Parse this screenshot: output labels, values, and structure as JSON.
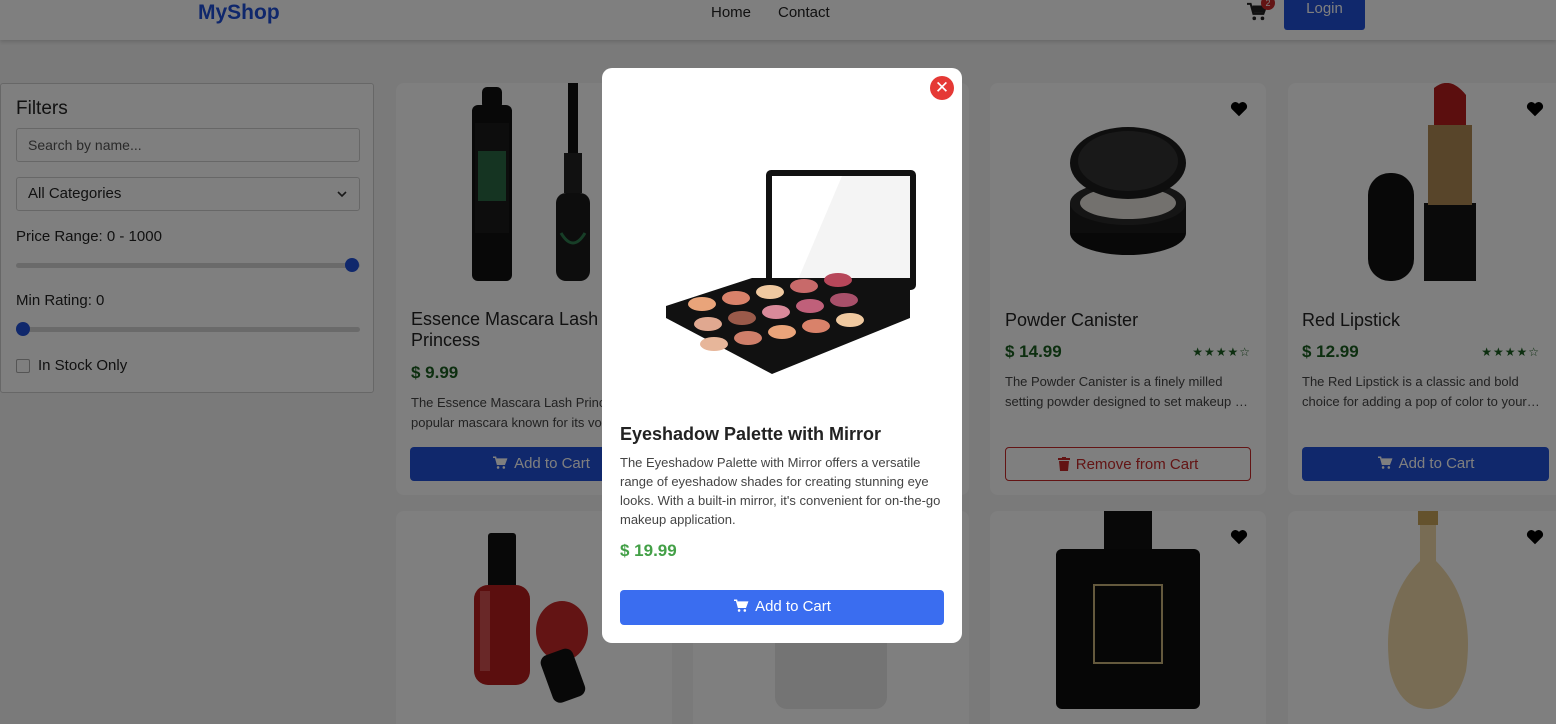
{
  "header": {
    "brand": "MyShop",
    "nav": {
      "home": "Home",
      "contact": "Contact"
    },
    "cart_count": "2",
    "login_label": "Login"
  },
  "filters": {
    "title": "Filters",
    "search_placeholder": "Search by name...",
    "category_value": "All Categories",
    "price_label": "Price Range: 0 - 1000",
    "price_max": 1000,
    "rating_label": "Min Rating: 0",
    "rating_value": 0,
    "in_stock_label": "In Stock Only",
    "in_stock_checked": false
  },
  "products": [
    {
      "name": "Essence Mascara Lash Princess",
      "name_line1": "Essence Mascara Lash",
      "name_line2": "Princess",
      "price": "$ 9.99",
      "desc_line1": "The Essence Mascara Lash Princess is a",
      "desc_line2": "popular mascara known for its volumizing",
      "button": "Add to Cart"
    },
    {
      "name": "Powder Canister",
      "price": "$ 14.99",
      "stars": "★★★★☆",
      "desc_line1": "The Powder Canister is a finely milled",
      "desc_line2": "setting powder designed to set makeup and control shine.",
      "button": "Remove from Cart"
    },
    {
      "name": "Red Lipstick",
      "price": "$ 12.99",
      "stars": "★★★★☆",
      "desc_line1": "The Red Lipstick is a classic and bold",
      "desc_line2": "choice for adding a pop of color to your lips.",
      "button": "Add to Cart"
    }
  ],
  "modal": {
    "title": "Eyeshadow Palette with Mirror",
    "description": "The Eyeshadow Palette with Mirror offers a versatile range of eyeshadow shades for creating stunning eye looks. With a built-in mirror, it's convenient for on-the-go makeup application.",
    "price": "$ 19.99",
    "add_label": "Add to Cart",
    "close_symbol": "✕"
  },
  "colors": {
    "brand": "#1e4fd8",
    "primary_button": "#2150d8",
    "modal_button": "#3a6df0",
    "price_green": "#1b5e20",
    "modal_price_green": "#43a047",
    "danger": "#c62828"
  },
  "icons": [
    "cart-icon",
    "chevron-down-icon",
    "heart-icon",
    "trash-icon",
    "close-icon"
  ]
}
